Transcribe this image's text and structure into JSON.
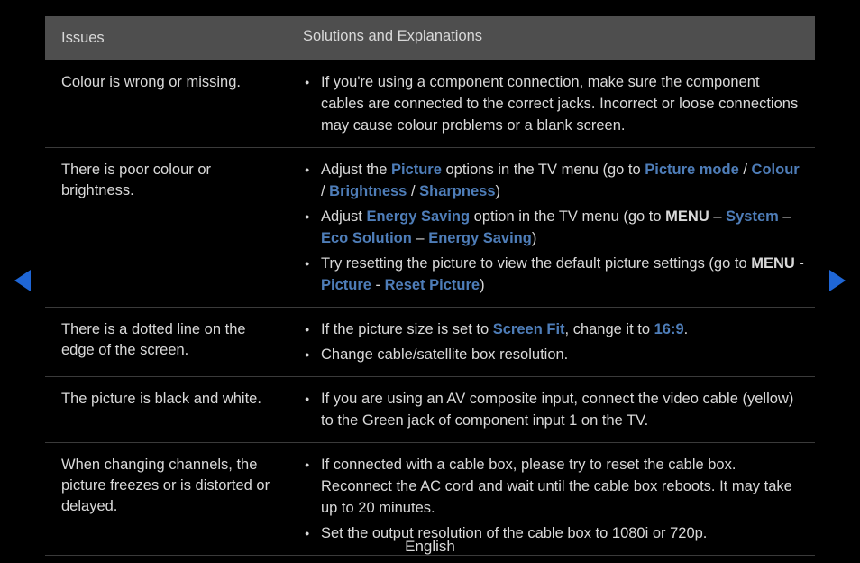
{
  "nav": {
    "prev": "prev",
    "next": "next"
  },
  "table": {
    "headers": {
      "issues": "Issues",
      "solutions": "Solutions and Explanations"
    }
  },
  "rows": {
    "r0": {
      "issue": "Colour is wrong or missing.",
      "b0": "If you're using a component connection, make sure the component cables are connected to the correct jacks. Incorrect or loose connections may cause colour problems or a blank screen."
    },
    "r1": {
      "issue": "There is poor colour or brightness.",
      "b0a": "Adjust the ",
      "b0_picture": "Picture",
      "b0b": " options in the TV menu (go to ",
      "b0_picture_mode": "Picture mode",
      "b0_sep1": " / ",
      "b0_colour": "Colour",
      "b0_sep2": " / ",
      "b0_brightness": "Brightness",
      "b0_sep3": " / ",
      "b0_sharpness": "Sharpness",
      "b0c": ")",
      "b1a": "Adjust ",
      "b1_energy": "Energy Saving",
      "b1b": " option in the TV menu (go to ",
      "b1_menu": "MENU",
      "b1_sep1": " – ",
      "b1_system": "System",
      "b1_sep2": " – ",
      "b1_eco": "Eco Solution",
      "b1_sep3": " – ",
      "b1_energy2": "Energy Saving",
      "b1c": ")",
      "b2a": "Try resetting the picture to view the default picture settings (go to ",
      "b2_menu": "MENU",
      "b2_sep1": " - ",
      "b2_picture": "Picture",
      "b2_sep2": " - ",
      "b2_reset": "Reset Picture",
      "b2c": ")"
    },
    "r2": {
      "issue": "There is a dotted line on the edge of the screen.",
      "b0a": "If the picture size is set to ",
      "b0_screenfit": "Screen Fit",
      "b0b": ", change it to ",
      "b0_169": "16:9",
      "b0c": ".",
      "b1": "Change cable/satellite box resolution."
    },
    "r3": {
      "issue": "The picture is black and white.",
      "b0": "If you are using an AV composite input, connect the video cable (yellow) to the Green jack of component input 1 on the TV."
    },
    "r4": {
      "issue": "When changing channels, the picture freezes or is distorted or delayed.",
      "b0": "If connected with a cable box, please try to reset the cable box. Reconnect the AC cord and wait until the cable box reboots. It may take up to 20 minutes.",
      "b1": "Set the output resolution of the cable box to 1080i or 720p."
    }
  },
  "footer": {
    "language": "English"
  }
}
